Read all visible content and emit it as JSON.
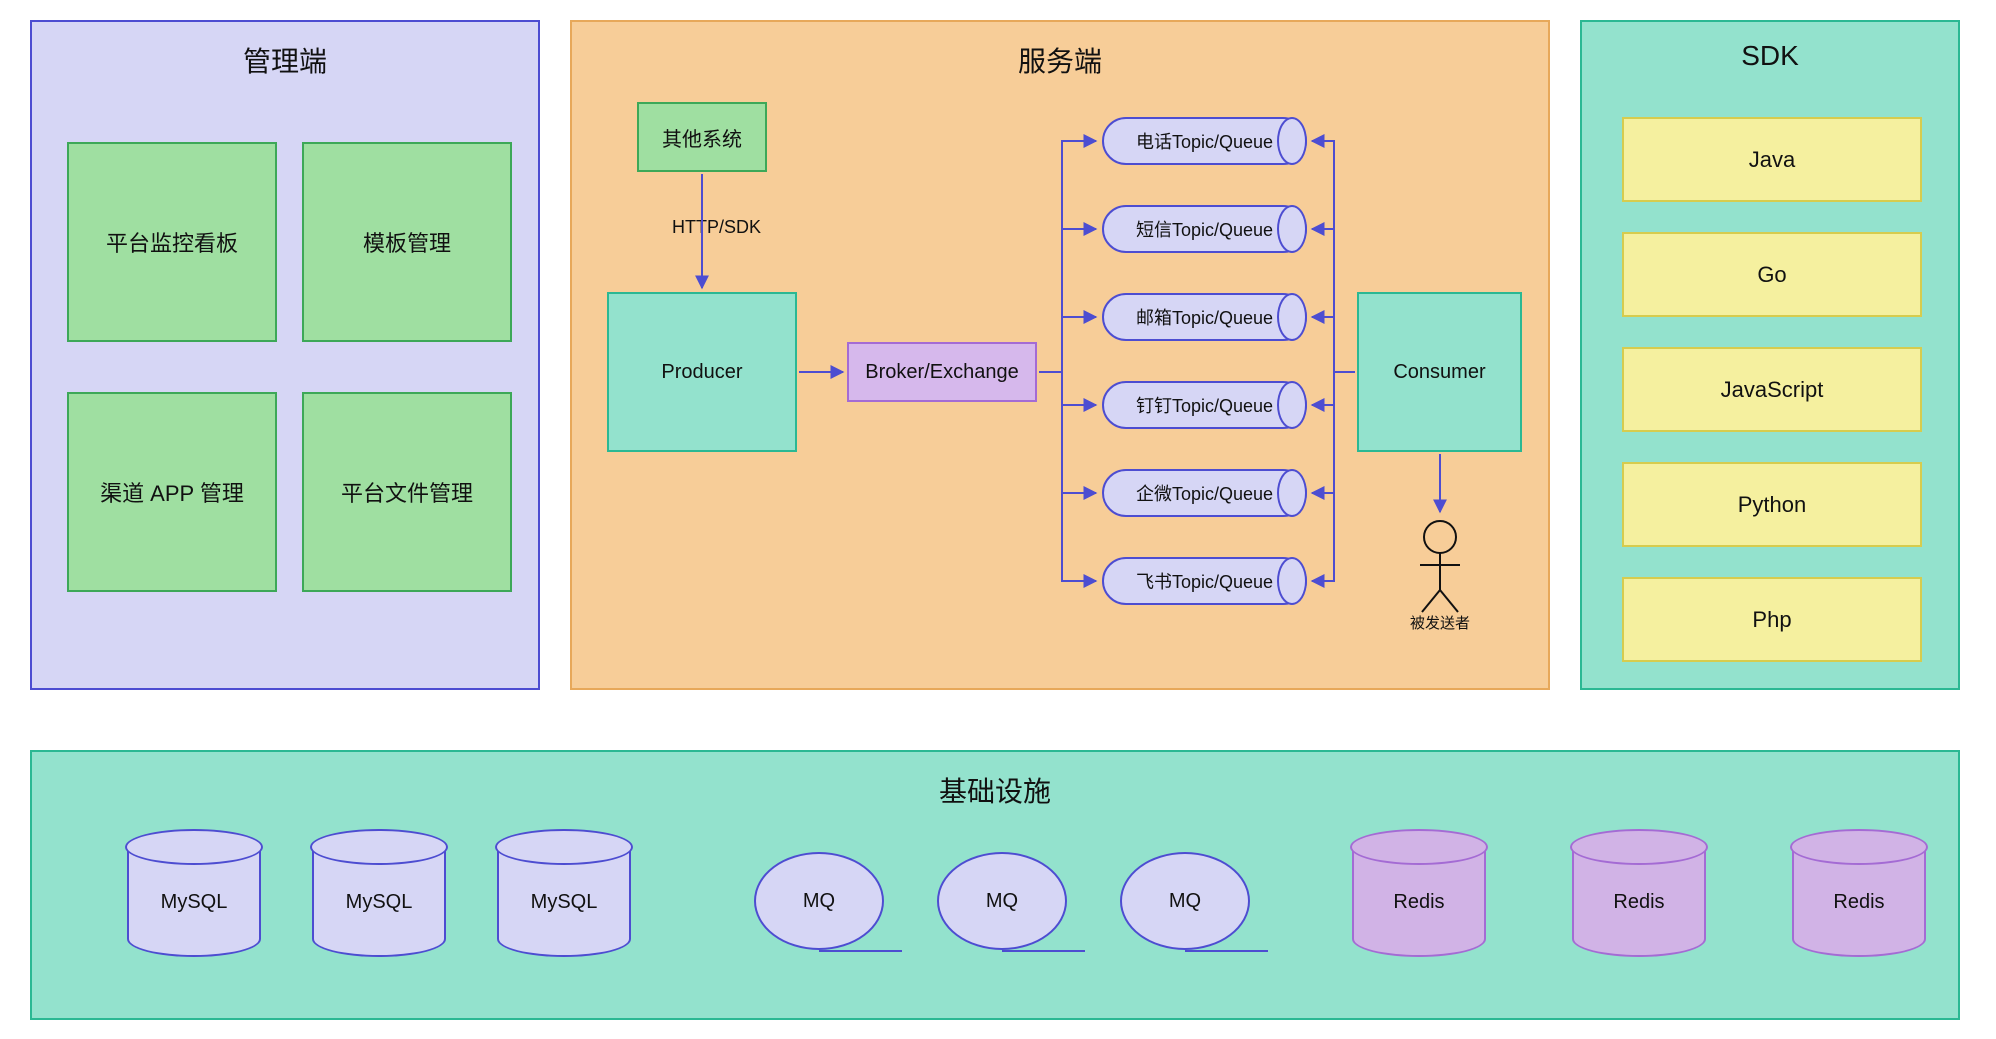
{
  "mgmt": {
    "title": "管理端",
    "boxes": [
      "平台监控看板",
      "模板管理",
      "渠道 APP 管理",
      "平台文件管理"
    ]
  },
  "srv": {
    "title": "服务端",
    "other_sys": "其他系统",
    "http_label": "HTTP/SDK",
    "producer": "Producer",
    "broker": "Broker/Exchange",
    "consumer": "Consumer",
    "sendee": "被发送者",
    "topics": [
      "电话Topic/Queue",
      "短信Topic/Queue",
      "邮箱Topic/Queue",
      "钉钉Topic/Queue",
      "企微Topic/Queue",
      "飞书Topic/Queue"
    ]
  },
  "sdk": {
    "title": "SDK",
    "items": [
      "Java",
      "Go",
      "JavaScript",
      "Python",
      "Php"
    ]
  },
  "infra": {
    "title": "基础设施",
    "mysql_label": "MySQL",
    "mq_label": "MQ",
    "redis_label": "Redis"
  },
  "colors": {
    "purple_fill": "#d6d6f5",
    "purple_border": "#4d4dd1",
    "orange_fill": "#f7cd98",
    "orange_border": "#e7a85a",
    "teal_fill": "#93e2cd",
    "teal_border": "#2bb893",
    "green_fill": "#9fdfa1",
    "green_border": "#3da858",
    "lilac_fill": "#d6b8ec",
    "lilac_border": "#a46bd4",
    "yellow_fill": "#f5f09f",
    "yellow_border": "#d6cc4e",
    "violet_fill": "#d1b3e6",
    "violet_border": "#a46bd4"
  }
}
